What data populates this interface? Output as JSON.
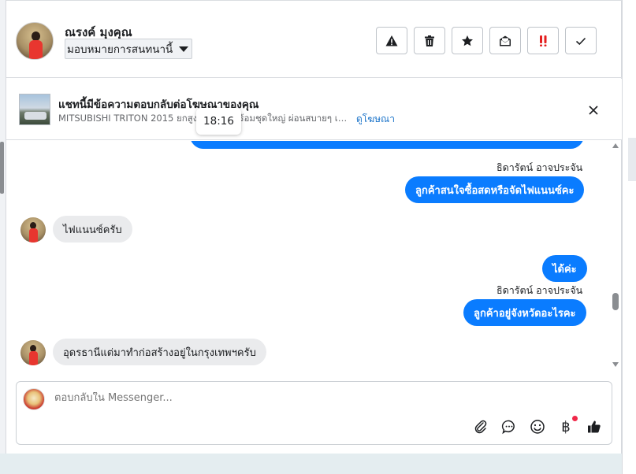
{
  "header": {
    "contact_name": "ณรงค์ มุงคุณ",
    "assign_label": "มอบหมายการสนทนานี้",
    "actions": [
      {
        "icon": "warning-icon"
      },
      {
        "icon": "trash-icon"
      },
      {
        "icon": "star-icon"
      },
      {
        "icon": "envelope-open-icon"
      },
      {
        "icon": "double-exclamation-icon",
        "color": "#e41e1e"
      },
      {
        "icon": "check-icon"
      }
    ]
  },
  "ad_banner": {
    "title": "แชทนี้มีข้อความตอบกลับต่อโฆษณาของคุณ",
    "description": "MITSUBISHI TRITON 2015 ยกสูง 4 ประตู พร้อมชุดใหญ่ ผ่อนสบายๆ เริ่มต้...",
    "link": "ดูโฆษณา",
    "tooltip_time": "18:16"
  },
  "messages": [
    {
      "direction": "out",
      "sender": "ธิดารัตน์ อาจประจัน",
      "text": "ลูกค้าสนใจซื้อสดหรือจัดไฟแนนซ์คะ"
    },
    {
      "direction": "in",
      "text": "ไฟแนนซ์ครับ"
    },
    {
      "direction": "out",
      "text": "ได้ค่ะ"
    },
    {
      "direction": "out",
      "sender": "ธิดารัตน์ อาจประจัน",
      "text": "ลูกค้าอยู่จังหวัดอะไรคะ"
    },
    {
      "direction": "in",
      "text": "อุดรธานีแต่มาทำก่อสร้างอยู่ในกรุงเทพฯครับ"
    }
  ],
  "composer": {
    "placeholder": "ตอบกลับใน Messenger...",
    "baht_symbol": "฿"
  },
  "colors": {
    "accent": "#0a7cff",
    "incoming_bubble": "#eaebed",
    "link": "#1a73c9"
  }
}
